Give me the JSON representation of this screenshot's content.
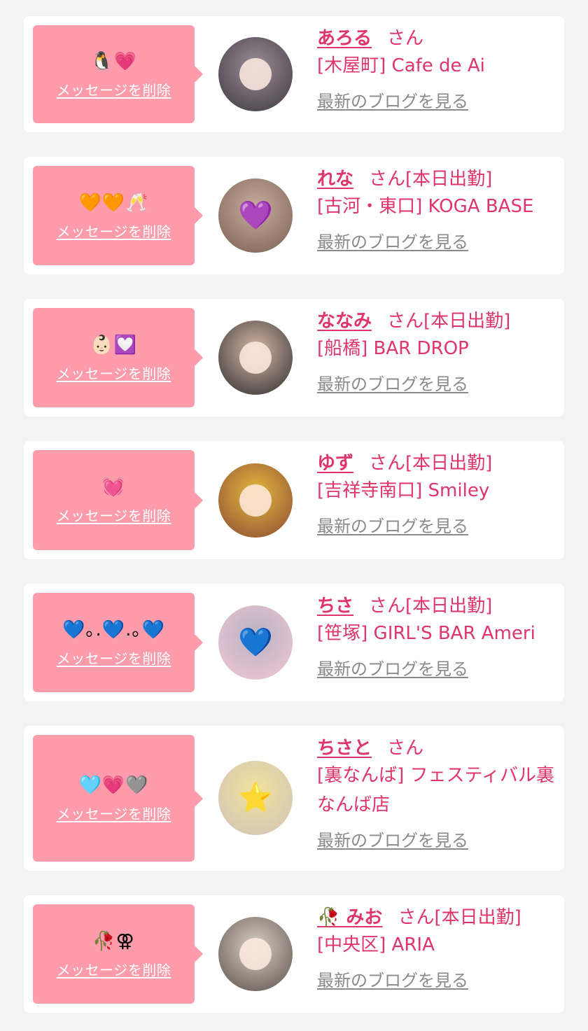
{
  "cards": [
    {
      "emoji": "🐧💗",
      "delete_label": "メッセージを削除",
      "name": "あろる",
      "san": "さん",
      "status": "",
      "shop": "[木屋町] Cafe de Ai",
      "blog_label": "最新のブログを見る",
      "avatar_colors": [
        "#3e3640",
        "#9c8f99"
      ]
    },
    {
      "emoji": "🧡🧡🥂",
      "delete_label": "メッセージを削除",
      "name": "れな",
      "san": "さん",
      "status": "[本日出勤]",
      "shop": "[古河・東口] KOGA BASE",
      "blog_label": "最新のブログを見る",
      "avatar_colors": [
        "#7a5e52",
        "#c9ad9f"
      ],
      "avatar_mark": "💜"
    },
    {
      "emoji": "👶🏻💟",
      "delete_label": "メッセージを削除",
      "name": "ななみ",
      "san": "さん",
      "status": "[本日出勤]",
      "shop": "[船橋] BAR DROP",
      "blog_label": "最新のブログを見る",
      "avatar_colors": [
        "#2b2b2e",
        "#d8b9a6"
      ]
    },
    {
      "emoji": "💓",
      "delete_label": "メッセージを削除",
      "name": "ゆず",
      "san": "さん",
      "status": "[本日出勤]",
      "shop": "[吉祥寺南口] Smiley",
      "blog_label": "最新のブログを見る",
      "avatar_colors": [
        "#8a4a33",
        "#e3b93f"
      ]
    },
    {
      "emoji": "💙｡.💙.｡💙",
      "delete_label": "メッセージを削除",
      "name": "ちさ",
      "san": "さん",
      "status": "[本日出勤]",
      "shop": "[笹塚] GIRL'S BAR Ameri",
      "blog_label": "最新のブログを見る",
      "avatar_colors": [
        "#f3c6d6",
        "#b8b3c2"
      ],
      "avatar_mark": "💙"
    },
    {
      "emoji": "🩵💗🩶",
      "delete_label": "メッセージを削除",
      "name": "ちさと",
      "san": "さん",
      "status": "",
      "shop": "[裏なんば] フェスティバル裏なんば店",
      "blog_label": "最新のブログを見る",
      "avatar_colors": [
        "#cfc3b8",
        "#f2e29c"
      ],
      "avatar_mark": "⭐"
    },
    {
      "emoji": "🥀⚢",
      "delete_label": "メッセージを削除",
      "name": "🥀 みお",
      "san": "さん",
      "status": "[本日出勤]",
      "shop": "[中央区] ARIA",
      "blog_label": "最新のブログを見る",
      "avatar_colors": [
        "#5b5048",
        "#d9cfc7"
      ]
    }
  ],
  "colors": {
    "page_bg": "#f3f3f3",
    "card_bg": "#ffffff",
    "bubble_bg": "#ff9cab",
    "accent": "#e0356a",
    "link_gray": "#8a8a8a"
  }
}
